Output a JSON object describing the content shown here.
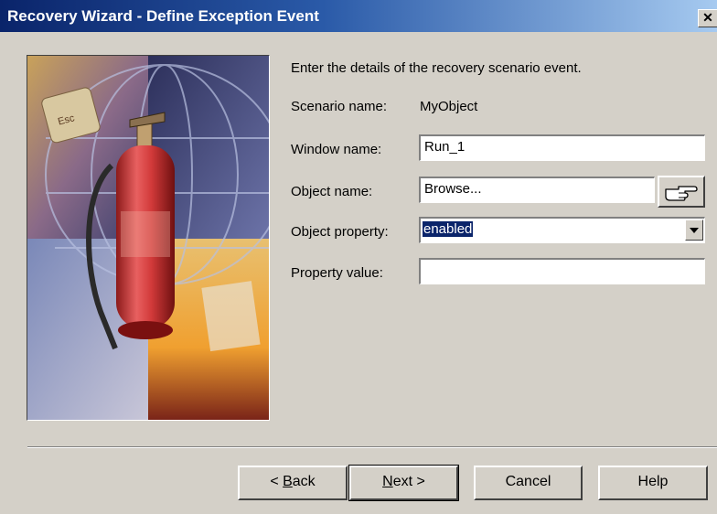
{
  "window": {
    "title": "Recovery Wizard - Define Exception Event",
    "close_glyph": "✕"
  },
  "intro": "Enter the details of the recovery scenario event.",
  "form": {
    "scenario_name_label": "Scenario name:",
    "scenario_name_value": "MyObject",
    "window_name_label": "Window name:",
    "window_name_value": "Run_1",
    "object_name_label": "Object name:",
    "object_name_value": "Browse...",
    "object_property_label": "Object property:",
    "object_property_value": "enabled",
    "property_value_label": "Property value:",
    "property_value_value": ""
  },
  "buttons": {
    "back_prefix": "< ",
    "back_hotkey": "B",
    "back_rest": "ack",
    "next_hotkey": "N",
    "next_rest": "ext >",
    "cancel": "Cancel",
    "help": "Help"
  },
  "icons": {
    "pointer": "pointing-hand-icon",
    "dropdown": "chevron-down-icon",
    "close": "close-icon"
  },
  "colors": {
    "face": "#d4d0c8",
    "title_start": "#0a246a",
    "title_end": "#a6caf0",
    "selection": "#0a246a"
  }
}
